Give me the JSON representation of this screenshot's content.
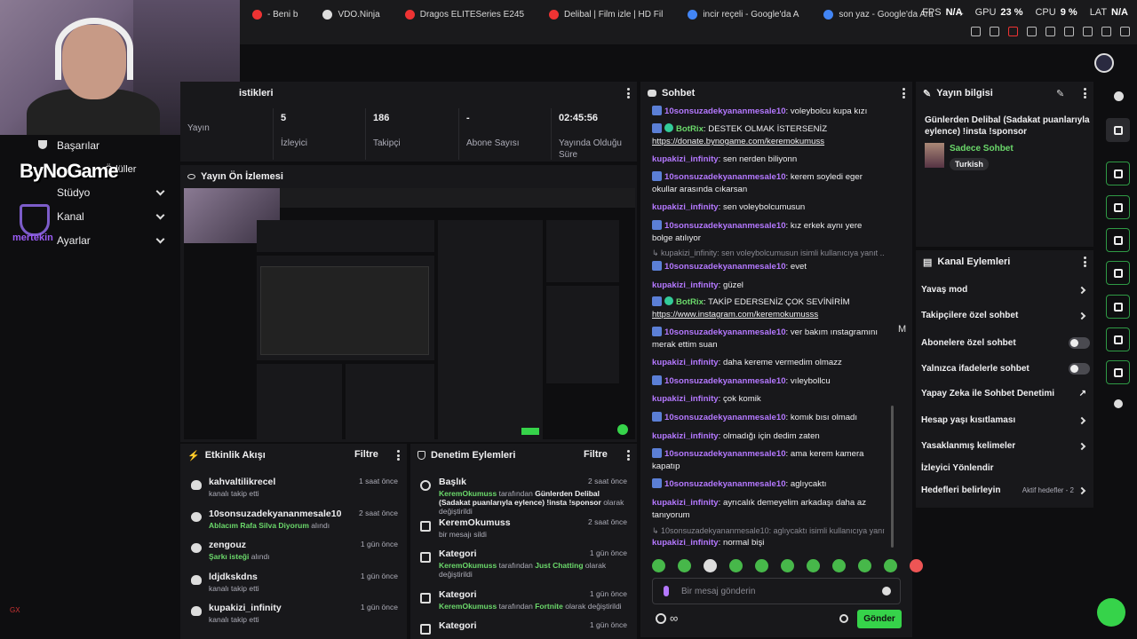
{
  "browser": {
    "tabs": [
      {
        "label": "- Beni b",
        "color": "#e33"
      },
      {
        "label": "VDO.Ninja",
        "color": "#ddd"
      },
      {
        "label": "Dragos ELITESeries E245",
        "color": "#e33"
      },
      {
        "label": "Delibal | Film izle | HD Fil",
        "color": "#e33"
      },
      {
        "label": "incir reçeli - Google'da A",
        "color": "#4285f4"
      },
      {
        "label": "son yaz - Google'da Ara",
        "color": "#4285f4"
      }
    ],
    "new_tab": "+",
    "stats": [
      {
        "label": "FPS",
        "value": "N/A"
      },
      {
        "label": "GPU",
        "value": "23 %"
      },
      {
        "label": "CPU",
        "value": "9 %"
      },
      {
        "label": "LAT",
        "value": "N/A"
      }
    ]
  },
  "overlay": {
    "logo_text": "ByNoGame",
    "brand_text": "mertekin",
    "small_text": "GX"
  },
  "sidebar": {
    "items": [
      {
        "label": "Başarılar",
        "chevron": false
      },
      {
        "label": "Stüdyo",
        "chevron": true
      },
      {
        "label": "Kanal",
        "chevron": true
      },
      {
        "label": "Ayarlar",
        "chevron": true
      }
    ],
    "hidden_item": "Ödüller"
  },
  "stats_panel": {
    "title": "istikleri",
    "cells": [
      {
        "value": "",
        "label": "Yayın"
      },
      {
        "value": "5",
        "label": "İzleyici"
      },
      {
        "value": "186",
        "label": "Takipçi"
      },
      {
        "value": "-",
        "label": "Abone Sayısı"
      },
      {
        "value": "02:45:56",
        "label": "Yayında Olduğu Süre"
      }
    ]
  },
  "preview": {
    "title": "Yayın Ön İzlemesi"
  },
  "activity": {
    "title": "Etkinlik Akışı",
    "filter": "Filtre",
    "items": [
      {
        "name": "kahvaltilikrecel",
        "sub": "kanalı takip etti",
        "highlight": "",
        "time": "1 saat önce"
      },
      {
        "name": "10sonsuzadekyananmesale10",
        "sub": "alındı",
        "highlight": "Ablacım Rafa Silva Diyorum",
        "time": "2 saat önce"
      },
      {
        "name": "zengouz",
        "sub": "alındı",
        "highlight": "Şarkı isteği",
        "time": "1 gün önce"
      },
      {
        "name": "ldjdkskdns",
        "sub": "kanalı takip etti",
        "highlight": "",
        "time": "1 gün önce"
      },
      {
        "name": "kupakizi_infinity",
        "sub": "kanalı takip etti",
        "highlight": "",
        "time": "1 gün önce"
      }
    ]
  },
  "moderation": {
    "title": "Denetim Eylemleri",
    "filter": "Filtre",
    "items": [
      {
        "title": "Başlık",
        "actor": "KeremOkumuss",
        "mid": "tarafından",
        "value": "Günlerden Delibal (Sadakat puanlarıyla eylence) !insta !sponsor",
        "tail": "olarak değiştirildi",
        "time": "2 saat önce"
      },
      {
        "title": "KeremOkumuss",
        "actor": "",
        "mid": "",
        "value": "",
        "tail": "bir mesajı sildi",
        "time": "2 saat önce"
      },
      {
        "title": "Kategori",
        "actor": "KeremOkumuss",
        "mid": "tarafından",
        "value": "Just Chatting",
        "tail": "olarak değiştirildi",
        "time": "1 gün önce"
      },
      {
        "title": "Kategori",
        "actor": "KeremOkumuss",
        "mid": "tarafından",
        "value": "Fortnite",
        "tail": "olarak değiştirildi",
        "time": "1 gün önce"
      },
      {
        "title": "Kategori",
        "actor": "",
        "mid": "",
        "value": "",
        "tail": "",
        "time": "1 gün önce"
      }
    ]
  },
  "chat": {
    "title": "Sohbet",
    "messages": [
      {
        "user": "10sonsuzadekyananmesale10",
        "text": "voleybolcu kupa kızı",
        "badge": true,
        "bot": false
      },
      {
        "user": "BotRix",
        "text": "DESTEK OLMAK İSTERSENİZ",
        "link": "https://donate.bynogame.com/keremokumuss",
        "badge": true,
        "bot": true
      },
      {
        "user": "kupakizi_infinity",
        "text": "sen nerden biliyonn",
        "badge": false,
        "bot": false
      },
      {
        "user": "10sonsuzadekyananmesale10",
        "text": "kerem soyledi eger okullar arasında cıkarsan",
        "badge": true,
        "bot": false
      },
      {
        "user": "kupakizi_infinity",
        "text": "sen voleybolcumusun",
        "badge": false,
        "bot": false
      },
      {
        "user": "10sonsuzadekyananmesale10",
        "text": "kız erkek aynı yere bolge atılıyor",
        "badge": true,
        "bot": false
      },
      {
        "reply": "kupakizi_infinity: sen voleybolcumusun isimli kullanıcıya yanıt ..."
      },
      {
        "user": "10sonsuzadekyananmesale10",
        "text": "evet",
        "badge": true,
        "bot": false
      },
      {
        "user": "kupakizi_infinity",
        "text": "güzel",
        "badge": false,
        "bot": false
      },
      {
        "user": "BotRix",
        "text": "TAKİP EDERSENİZ ÇOK SEVİNİRİM",
        "link": "https://www.instagram.com/keremokumusss",
        "badge": true,
        "bot": true
      },
      {
        "user": "10sonsuzadekyananmesale10",
        "text": "ver bakım ınstagramını merak ettim suan",
        "badge": true,
        "bot": false
      },
      {
        "user": "kupakizi_infinity",
        "text": "daha kereme vermedim olmazz",
        "badge": false,
        "bot": false
      },
      {
        "user": "10sonsuzadekyananmesale10",
        "text": "vıleybollcu",
        "badge": true,
        "bot": false
      },
      {
        "user": "kupakizi_infinity",
        "text": "çok komik",
        "badge": false,
        "bot": false
      },
      {
        "user": "10sonsuzadekyananmesale10",
        "text": "komık bısı olmadı",
        "badge": true,
        "bot": false
      },
      {
        "user": "kupakizi_infinity",
        "text": "olmadığı için dedim zaten",
        "badge": false,
        "bot": false
      },
      {
        "user": "10sonsuzadekyananmesale10",
        "text": "ama kerem kamera kapatıp",
        "badge": true,
        "bot": false
      },
      {
        "user": "10sonsuzadekyananmesale10",
        "text": "aglıycaktı",
        "badge": true,
        "bot": false
      },
      {
        "user": "kupakizi_infinity",
        "text": "ayrıcalık demeyelim arkadaşı daha az tanıyorum",
        "badge": false,
        "bot": false
      },
      {
        "reply": "10sonsuzadekyananmesale10: aglıycaktı isimli kullanıcıya yanıt..."
      },
      {
        "user": "kupakizi_infinity",
        "text": "normal bişi",
        "badge": false,
        "bot": false
      }
    ],
    "input_placeholder": "Bir mesaj gönderin",
    "send_label": "Gönder",
    "side_letter": "M"
  },
  "stream_info": {
    "title": "Yayın bilgisi",
    "stream_title": "Günlerden Delibal (Sadakat puanlarıyla eylence) !insta !sponsor",
    "category": "Sadece Sohbet",
    "language": "Turkish"
  },
  "channel_actions": {
    "title": "Kanal Eylemleri",
    "items": [
      {
        "label": "Yavaş mod",
        "control": "arrow"
      },
      {
        "label": "Takipçilere özel sohbet",
        "control": "arrow"
      },
      {
        "label": "Abonelere özel sohbet",
        "control": "toggle"
      },
      {
        "label": "Yalnızca ifadelerle sohbet",
        "control": "toggle"
      },
      {
        "label": "Yapay Zeka ile Sohbet Denetimi",
        "control": "external"
      },
      {
        "label": "Hesap yaşı kısıtlaması",
        "control": "arrow"
      },
      {
        "label": "Yasaklanmış kelimeler",
        "control": "arrow"
      },
      {
        "label": "İzleyici Yönlendir",
        "control": "none"
      },
      {
        "label": "Hedefleri belirleyin",
        "control": "arrow",
        "extra": "Aktif hedefler - 2"
      }
    ]
  }
}
